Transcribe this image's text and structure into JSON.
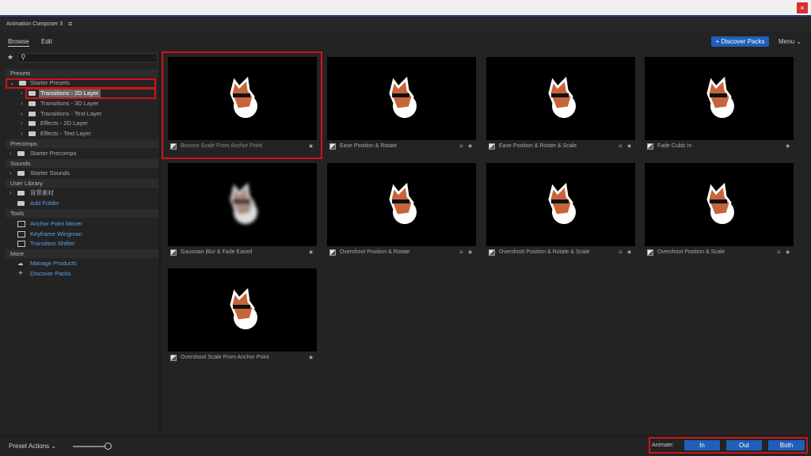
{
  "window": {
    "close_label": "×"
  },
  "panel": {
    "title": "Animation Composer 3",
    "menu_glyph": "≡"
  },
  "tabs": [
    {
      "label": "Browse"
    },
    {
      "label": "Edit"
    }
  ],
  "toolbar": {
    "discover_packs": "+ Discover Packs",
    "menu": "Menu ⌄"
  },
  "sidebar": {
    "sections": {
      "presets": "Presets",
      "precomps": "Precomps",
      "sounds": "Sounds",
      "user_library": "User Library",
      "tools": "Tools",
      "more": "More"
    },
    "presets": {
      "root": "Starter Presets",
      "children": [
        "Transitions - 2D Layer",
        "Transitions - 3D Layer",
        "Transitions - Text Layer",
        "Effects - 2D Layer",
        "Effects - Text Layer"
      ]
    },
    "precomps": [
      "Starter Precomps"
    ],
    "sounds": [
      "Starter Sounds"
    ],
    "user_library": [
      "背景素材",
      "Add Folder"
    ],
    "tools": [
      "Anchor Point Mover",
      "Keyframe Wingman",
      "Transition Shifter"
    ],
    "more": [
      "Manage Products",
      "Discover Packs"
    ]
  },
  "presets_grid": [
    {
      "label": "Bounce Scale From Anchor Point"
    },
    {
      "label": "Ease Position & Rotate"
    },
    {
      "label": "Ease Position & Rotate & Scale"
    },
    {
      "label": "Fade Cubic In"
    },
    {
      "label": "Gaussian Blur & Fade Eased"
    },
    {
      "label": "Overshoot Position & Rotate"
    },
    {
      "label": "Overshoot Position & Rotate & Scale"
    },
    {
      "label": "Overshoot Position & Scale"
    },
    {
      "label": "Overshoot Scale From Anchor Point"
    }
  ],
  "bottom": {
    "preset_actions": "Preset Actions  ⌄",
    "animate_label": "Animate:",
    "in": "In",
    "out": "Out",
    "both": "Both"
  },
  "colors": {
    "accent": "#1f5fb8",
    "highlight": "#d0141b",
    "link": "#5aa0e8"
  }
}
